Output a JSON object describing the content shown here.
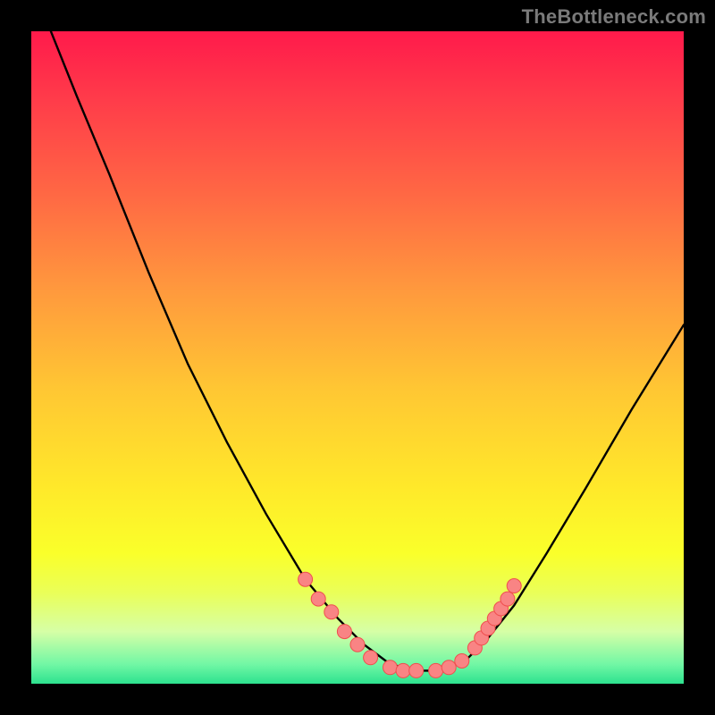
{
  "watermark": "TheBottleneck.com",
  "colors": {
    "background": "#000000",
    "curve_stroke": "#000000",
    "marker_fill": "#f98484",
    "marker_stroke": "#f04e4e"
  },
  "chart_data": {
    "type": "line",
    "title": "",
    "xlabel": "",
    "ylabel": "",
    "xlim": [
      0,
      100
    ],
    "ylim": [
      0,
      100
    ],
    "grid": false,
    "legend": false,
    "series": [
      {
        "name": "bottleneck-curve",
        "x": [
          0,
          3,
          7,
          12,
          18,
          24,
          30,
          36,
          42,
          47,
          51,
          55,
          59,
          63,
          67,
          70,
          74,
          79,
          85,
          92,
          100
        ],
        "y": [
          110,
          100,
          90,
          78,
          63,
          49,
          37,
          26,
          16,
          10,
          6,
          3,
          2,
          2,
          4,
          7,
          12,
          20,
          30,
          42,
          55
        ]
      }
    ],
    "markers": [
      {
        "name": "left-marker-1",
        "x": 42,
        "y": 16
      },
      {
        "name": "left-marker-2",
        "x": 44,
        "y": 13
      },
      {
        "name": "left-marker-3",
        "x": 46,
        "y": 11
      },
      {
        "name": "left-marker-4",
        "x": 48,
        "y": 8
      },
      {
        "name": "left-marker-5",
        "x": 50,
        "y": 6
      },
      {
        "name": "left-marker-6",
        "x": 52,
        "y": 4
      },
      {
        "name": "bottom-marker-1",
        "x": 55,
        "y": 2.5
      },
      {
        "name": "bottom-marker-2",
        "x": 57,
        "y": 2
      },
      {
        "name": "bottom-marker-3",
        "x": 59,
        "y": 2
      },
      {
        "name": "bottom-marker-4",
        "x": 62,
        "y": 2
      },
      {
        "name": "bottom-marker-5",
        "x": 64,
        "y": 2.5
      },
      {
        "name": "bottom-marker-6",
        "x": 66,
        "y": 3.5
      },
      {
        "name": "right-marker-1",
        "x": 68,
        "y": 5.5
      },
      {
        "name": "right-marker-2",
        "x": 69,
        "y": 7
      },
      {
        "name": "right-marker-3",
        "x": 70,
        "y": 8.5
      },
      {
        "name": "right-marker-4",
        "x": 71,
        "y": 10
      },
      {
        "name": "right-marker-5",
        "x": 72,
        "y": 11.5
      },
      {
        "name": "right-marker-6",
        "x": 73,
        "y": 13
      },
      {
        "name": "right-marker-7",
        "x": 74,
        "y": 15
      }
    ]
  }
}
